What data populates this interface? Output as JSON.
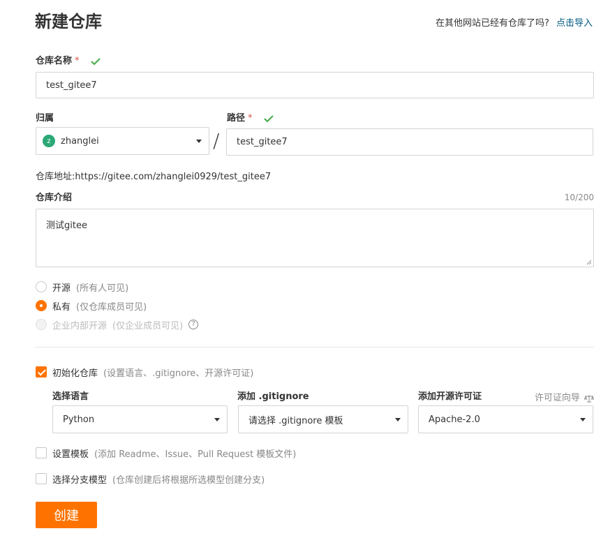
{
  "page": {
    "title": "新建仓库",
    "import_prompt": "在其他网站已经有仓库了吗?",
    "import_link": "点击导入"
  },
  "repo_name": {
    "label": "仓库名称",
    "required_mark": "*",
    "value": "test_gitee7"
  },
  "owner": {
    "label": "归属",
    "avatar_letter": "z",
    "value": "zhanglei"
  },
  "separator": "/",
  "path": {
    "label": "路径",
    "required_mark": "*",
    "value": "test_gitee7"
  },
  "repo_address": {
    "label": "仓库地址:",
    "url": "https://gitee.com/zhanglei0929/test_gitee7"
  },
  "description": {
    "label": "仓库介绍",
    "counter": "10/200",
    "value": "测试gitee"
  },
  "visibility": {
    "options": [
      {
        "label": "开源",
        "hint": "(所有人可见)",
        "selected": false,
        "disabled": false
      },
      {
        "label": "私有",
        "hint": "(仅仓库成员可见)",
        "selected": true,
        "disabled": false
      },
      {
        "label": "企业内部开源",
        "hint": "(仅企业成员可见)",
        "selected": false,
        "disabled": true
      }
    ],
    "help_icon": "?"
  },
  "init_repo": {
    "label": "初始化仓库",
    "hint": "(设置语言、.gitignore、开源许可证)",
    "checked": true
  },
  "language": {
    "label": "选择语言",
    "value": "Python"
  },
  "gitignore": {
    "label": "添加 .gitignore",
    "value": "请选择 .gitignore 模板"
  },
  "license": {
    "label": "添加开源许可证",
    "guide": "许可证向导",
    "value": "Apache-2.0"
  },
  "template": {
    "label": "设置模板",
    "hint": "(添加 Readme、Issue、Pull Request 模板文件)",
    "checked": false
  },
  "branch_model": {
    "label": "选择分支模型",
    "hint": "(仓库创建后将根据所选模型创建分支)",
    "checked": false
  },
  "create_button": "创建",
  "colors": {
    "accent": "#fe7300",
    "link": "#005980",
    "success": "#4caf50",
    "avatar": "#2aa876"
  }
}
